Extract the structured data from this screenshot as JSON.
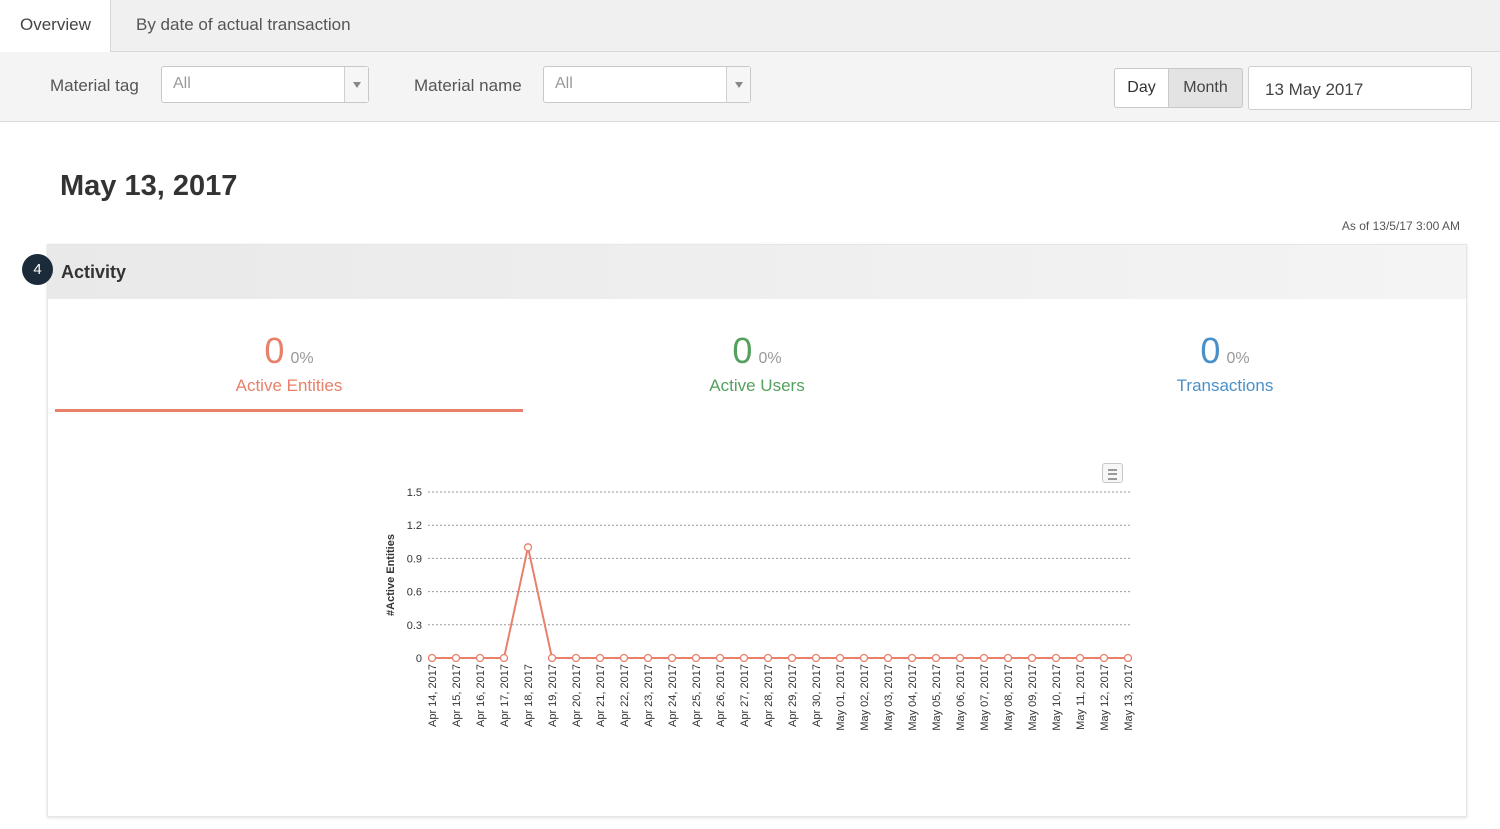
{
  "tabs": [
    {
      "label": "Overview"
    },
    {
      "label": "By date of actual transaction"
    }
  ],
  "filters": {
    "material_tag_label": "Material tag",
    "material_tag_value": "All",
    "material_name_label": "Material name",
    "material_name_value": "All",
    "period_day": "Day",
    "period_month": "Month",
    "date_value": "13 May 2017"
  },
  "page": {
    "title": "May 13, 2017",
    "as_of": "As of 13/5/17 3:00 AM"
  },
  "activity": {
    "badge": "4",
    "title": "Activity",
    "metrics": [
      {
        "value": "0",
        "pct": "0%",
        "label": "Active Entities",
        "color": "#e8806a"
      },
      {
        "value": "0",
        "pct": "0%",
        "label": "Active Users",
        "color": "#55a05f"
      },
      {
        "value": "0",
        "pct": "0%",
        "label": "Transactions",
        "color": "#4a90c8"
      }
    ]
  },
  "chart_data": {
    "type": "line",
    "title": "",
    "xlabel": "",
    "ylabel": "#Active Entities",
    "ylim": [
      0,
      1.5
    ],
    "yticks": [
      "0",
      "0.3",
      "0.6",
      "0.9",
      "1.2",
      "1.5"
    ],
    "grid": true,
    "color": "#e8806a",
    "categories": [
      "Apr 14, 2017",
      "Apr 15, 2017",
      "Apr 16, 2017",
      "Apr 17, 2017",
      "Apr 18, 2017",
      "Apr 19, 2017",
      "Apr 20, 2017",
      "Apr 21, 2017",
      "Apr 22, 2017",
      "Apr 23, 2017",
      "Apr 24, 2017",
      "Apr 25, 2017",
      "Apr 26, 2017",
      "Apr 27, 2017",
      "Apr 28, 2017",
      "Apr 29, 2017",
      "Apr 30, 2017",
      "May 01, 2017",
      "May 02, 2017",
      "May 03, 2017",
      "May 04, 2017",
      "May 05, 2017",
      "May 06, 2017",
      "May 07, 2017",
      "May 08, 2017",
      "May 09, 2017",
      "May 10, 2017",
      "May 11, 2017",
      "May 12, 2017",
      "May 13, 2017"
    ],
    "series": [
      {
        "values": [
          0,
          0,
          0,
          0,
          1,
          0,
          0,
          0,
          0,
          0,
          0,
          0,
          0,
          0,
          0,
          0,
          0,
          0,
          0,
          0,
          0,
          0,
          0,
          0,
          0,
          0,
          0,
          0,
          0,
          0
        ]
      }
    ]
  }
}
